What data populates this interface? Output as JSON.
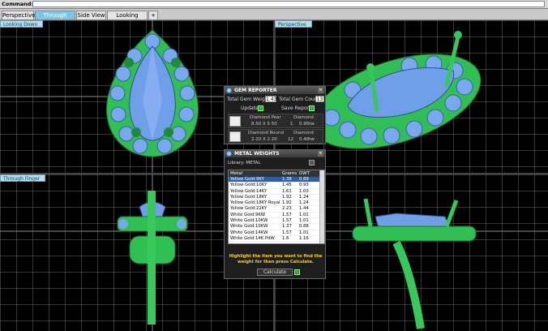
{
  "command_bar": {
    "label": "Command:"
  },
  "tabs": [
    {
      "label": "Perspective",
      "active": false
    },
    {
      "label": "Through Finger",
      "active": true
    },
    {
      "label": "Side View",
      "active": false
    },
    {
      "label": "Looking Down",
      "active": false
    },
    {
      "label": "+",
      "active": false
    }
  ],
  "viewports": {
    "top_left": {
      "label": "Looking Down"
    },
    "top_right": {
      "label": "Perspective"
    },
    "bottom_left": {
      "label": "Through Finger"
    },
    "bottom_right": {
      "label": ""
    }
  },
  "gem_reporter": {
    "title": "GEM REPORTER",
    "total_weight_label": "Total Gem Weight",
    "total_weight_value": "1.43",
    "total_count_label": "Total Gem Count",
    "total_count_value": "13",
    "update_label": "Update",
    "save_report_label": "Save Report",
    "gems": [
      {
        "shape": "Diamond Pear",
        "size": "8.50 X 5.50",
        "type": "Diamond",
        "count": "1",
        "weight": "0.95tw"
      },
      {
        "shape": "Diamond Round",
        "size": "2.20 X 2.20",
        "type": "Diamond",
        "count": "12",
        "weight": "0.48tw"
      }
    ]
  },
  "metal_weights": {
    "title": "METAL WEIGHTS",
    "library_label": "Library: METAL",
    "columns": [
      "Metal",
      "Grams",
      "DWT"
    ],
    "rows": [
      {
        "metal": "Yellow Gold:9KY",
        "grams": "1.38",
        "dwt": "0.89"
      },
      {
        "metal": "Yellow Gold:10KY",
        "grams": "1.45",
        "dwt": "0.93"
      },
      {
        "metal": "Yellow Gold:14KY",
        "grams": "1.61",
        "dwt": "1.03"
      },
      {
        "metal": "Yellow Gold:18KY",
        "grams": "1.92",
        "dwt": "1.24"
      },
      {
        "metal": "Yellow Gold:18KY Royal",
        "grams": "1.92",
        "dwt": "1.24"
      },
      {
        "metal": "Yellow Gold:22KY",
        "grams": "2.23",
        "dwt": "1.44"
      },
      {
        "metal": "White Gold:9KW",
        "grams": "1.57",
        "dwt": "1.01"
      },
      {
        "metal": "White Gold:10KW",
        "grams": "1.57",
        "dwt": "1.01"
      },
      {
        "metal": "White Gold:10KW",
        "grams": "1.37",
        "dwt": "0.88"
      },
      {
        "metal": "White Gold:14KW",
        "grams": "1.57",
        "dwt": "1.01"
      },
      {
        "metal": "White Gold:14K PdW",
        "grams": "1.6",
        "dwt": "1.16"
      }
    ],
    "selected_row": 0,
    "note": "Highlight the item you want to find the weight for then press Calculate.",
    "calculate_label": "Calculate"
  },
  "colors": {
    "gem_blue": "#6f9fe8",
    "metal_green": "#36c95a",
    "accent": "#7ac6e8"
  }
}
